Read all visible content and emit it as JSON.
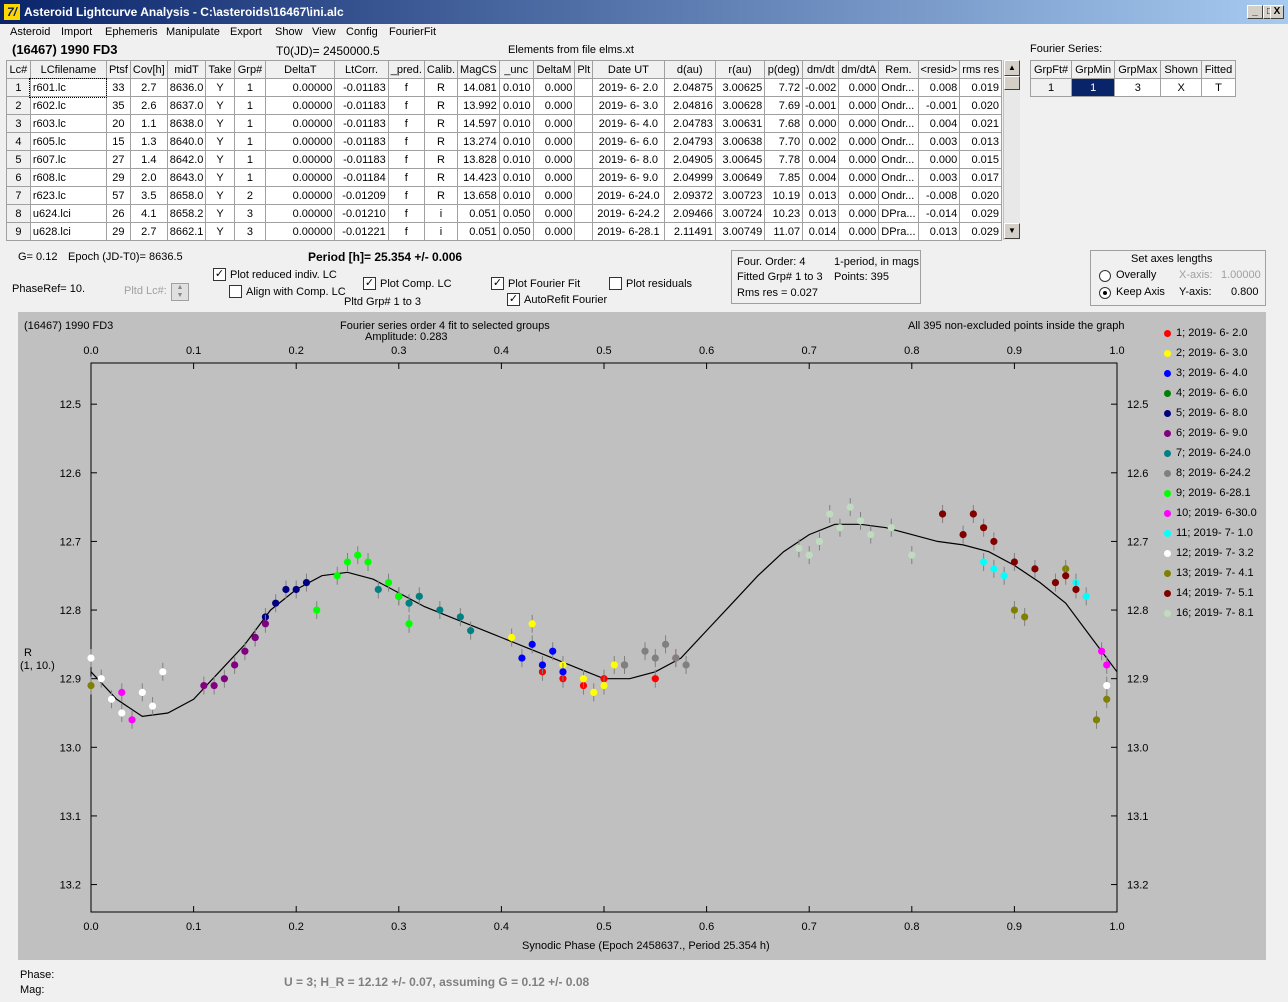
{
  "window": {
    "title": "Asteroid Lightcurve Analysis - C:\\asteroids\\16467\\ini.alc",
    "app_icon": "7/",
    "min": "_",
    "max": "□",
    "close": "X"
  },
  "menu": [
    "Asteroid",
    "Import",
    "Ephemeris",
    "Manipulate",
    "Export",
    "Show",
    "View",
    "Config",
    "FourierFit"
  ],
  "header": {
    "object": "(16467) 1990 FD3",
    "t0": "T0(JD)= 2450000.5",
    "elements": "Elements from file elms.xt",
    "fourier_series_label": "Fourier Series:"
  },
  "table": {
    "columns": [
      "Lc#",
      "LCfilename",
      "Ptsf",
      "Cov[h]",
      "midT",
      "Take",
      "Grp#",
      "DeltaT",
      "LtCorr.",
      "_pred.",
      "Calib.",
      "MagCS",
      "_unc",
      "DeltaM",
      "Plt",
      "Date UT",
      "d(au)",
      "r(au)",
      "p(deg)",
      "dm/dt",
      "dm/dtA",
      "Rem.",
      "<resid>",
      "rms res"
    ],
    "rows": [
      [
        "1",
        "r601.lc",
        "33",
        "2.7",
        "8636.0",
        "Y",
        "1",
        "0.00000",
        "-0.01183",
        "f",
        "R",
        "14.081",
        "0.010",
        "0.000",
        "",
        "2019- 6- 2.0",
        "2.04875",
        "3.00625",
        "7.72",
        "-0.002",
        "0.000",
        "Ondr...",
        "0.008",
        "0.019"
      ],
      [
        "2",
        "r602.lc",
        "35",
        "2.6",
        "8637.0",
        "Y",
        "1",
        "0.00000",
        "-0.01183",
        "f",
        "R",
        "13.992",
        "0.010",
        "0.000",
        "",
        "2019- 6- 3.0",
        "2.04816",
        "3.00628",
        "7.69",
        "-0.001",
        "0.000",
        "Ondr...",
        "-0.001",
        "0.020"
      ],
      [
        "3",
        "r603.lc",
        "20",
        "1.1",
        "8638.0",
        "Y",
        "1",
        "0.00000",
        "-0.01183",
        "f",
        "R",
        "14.597",
        "0.010",
        "0.000",
        "",
        "2019- 6- 4.0",
        "2.04783",
        "3.00631",
        "7.68",
        "0.000",
        "0.000",
        "Ondr...",
        "0.004",
        "0.021"
      ],
      [
        "4",
        "r605.lc",
        "15",
        "1.3",
        "8640.0",
        "Y",
        "1",
        "0.00000",
        "-0.01183",
        "f",
        "R",
        "13.274",
        "0.010",
        "0.000",
        "",
        "2019- 6- 6.0",
        "2.04793",
        "3.00638",
        "7.70",
        "0.002",
        "0.000",
        "Ondr...",
        "0.003",
        "0.013"
      ],
      [
        "5",
        "r607.lc",
        "27",
        "1.4",
        "8642.0",
        "Y",
        "1",
        "0.00000",
        "-0.01183",
        "f",
        "R",
        "13.828",
        "0.010",
        "0.000",
        "",
        "2019- 6- 8.0",
        "2.04905",
        "3.00645",
        "7.78",
        "0.004",
        "0.000",
        "Ondr...",
        "0.000",
        "0.015"
      ],
      [
        "6",
        "r608.lc",
        "29",
        "2.0",
        "8643.0",
        "Y",
        "1",
        "0.00000",
        "-0.01184",
        "f",
        "R",
        "14.423",
        "0.010",
        "0.000",
        "",
        "2019- 6- 9.0",
        "2.04999",
        "3.00649",
        "7.85",
        "0.004",
        "0.000",
        "Ondr...",
        "0.003",
        "0.017"
      ],
      [
        "7",
        "r623.lc",
        "57",
        "3.5",
        "8658.0",
        "Y",
        "2",
        "0.00000",
        "-0.01209",
        "f",
        "R",
        "13.658",
        "0.010",
        "0.000",
        "",
        "2019- 6-24.0",
        "2.09372",
        "3.00723",
        "10.19",
        "0.013",
        "0.000",
        "Ondr...",
        "-0.008",
        "0.020"
      ],
      [
        "8",
        "u624.lci",
        "26",
        "4.1",
        "8658.2",
        "Y",
        "3",
        "0.00000",
        "-0.01210",
        "f",
        "i",
        "0.051",
        "0.050",
        "0.000",
        "",
        "2019- 6-24.2",
        "2.09466",
        "3.00724",
        "10.23",
        "0.013",
        "0.000",
        "DPra...",
        "-0.014",
        "0.029"
      ],
      [
        "9",
        "u628.lci",
        "29",
        "2.7",
        "8662.1",
        "Y",
        "3",
        "0.00000",
        "-0.01221",
        "f",
        "i",
        "0.051",
        "0.050",
        "0.000",
        "",
        "2019- 6-28.1",
        "2.11491",
        "3.00749",
        "11.07",
        "0.014",
        "0.000",
        "DPra...",
        "0.013",
        "0.029"
      ]
    ]
  },
  "fourier_table": {
    "columns": [
      "GrpFt#",
      "GrpMin",
      "GrpMax",
      "Shown",
      "Fitted"
    ],
    "row": [
      "1",
      "1",
      "3",
      "X",
      "T"
    ]
  },
  "params": {
    "g": "G= 0.12",
    "epoch": "Epoch (JD-T0)= 8636.5",
    "period": "Period [h]= 25.354 +/- 0.006",
    "phaseref": "PhaseRef= 10.",
    "pltd_lc": "Pltd Lc#:",
    "pltd_grp": "Pltd Grp#  1   to   3"
  },
  "checks": {
    "plot_reduced": {
      "label": "Plot reduced indiv. LC",
      "checked": true
    },
    "align": {
      "label": "Align with Comp. LC",
      "checked": false
    },
    "plot_comp": {
      "label": "Plot Comp. LC",
      "checked": true
    },
    "plot_fourier": {
      "label": "Plot Fourier Fit",
      "checked": true
    },
    "autorefit": {
      "label": "AutoRefit Fourier",
      "checked": true
    },
    "plot_resid": {
      "label": "Plot residuals",
      "checked": false
    }
  },
  "info": {
    "order": "Four. Order:  4",
    "period_mode": "1-period, in mags",
    "fitted": "Fitted Grp# 1 to 3",
    "points": "Points: 395",
    "rms": "Rms res     = 0.027"
  },
  "axes_panel": {
    "title": "Set axes lengths",
    "overally": "Overally",
    "keep": "Keep Axis",
    "xlabel": "X-axis:",
    "xval": "1.00000",
    "ylabel": "Y-axis:",
    "yval": "0.800"
  },
  "plot": {
    "object": "(16467) 1990 FD3",
    "fit_title": "Fourier series order 4 fit to selected groups",
    "amplitude": "Amplitude: 0.283",
    "points_note": "All 395 non-excluded points inside the graph",
    "xlabel": "Synodic Phase (Epoch 2458637., Period 25.354 h)",
    "ylabel1": "R",
    "ylabel2": "(1, 10.)",
    "xticks": [
      "0.0",
      "0.1",
      "0.2",
      "0.3",
      "0.4",
      "0.5",
      "0.6",
      "0.7",
      "0.8",
      "0.9",
      "1.0"
    ],
    "yticks": [
      "12.5",
      "12.6",
      "12.7",
      "12.8",
      "12.9",
      "13.0",
      "13.1",
      "13.2"
    ]
  },
  "legend": [
    {
      "label": "1; 2019- 6- 2.0",
      "color": "#ff0000"
    },
    {
      "label": "2; 2019- 6- 3.0",
      "color": "#ffff00"
    },
    {
      "label": "3; 2019- 6- 4.0",
      "color": "#0000ff"
    },
    {
      "label": "4; 2019- 6- 6.0",
      "color": "#008000"
    },
    {
      "label": "5; 2019- 6- 8.0",
      "color": "#000080"
    },
    {
      "label": "6; 2019- 6- 9.0",
      "color": "#800080"
    },
    {
      "label": "7; 2019- 6-24.0",
      "color": "#008080"
    },
    {
      "label": "8; 2019- 6-24.2",
      "color": "#808080"
    },
    {
      "label": "9; 2019- 6-28.1",
      "color": "#00ff00"
    },
    {
      "label": "10; 2019- 6-30.0",
      "color": "#ff00ff"
    },
    {
      "label": "11; 2019- 7- 1.0",
      "color": "#00ffff"
    },
    {
      "label": "12; 2019- 7- 3.2",
      "color": "#ffffff"
    },
    {
      "label": "13; 2019- 7- 4.1",
      "color": "#808000"
    },
    {
      "label": "14; 2019- 7- 5.1",
      "color": "#800000"
    },
    {
      "label": "16; 2019- 7- 8.1",
      "color": "#c0dcc0"
    }
  ],
  "chart_data": {
    "type": "scatter",
    "xlim": [
      0,
      1
    ],
    "ylim": [
      13.2,
      12.4
    ],
    "inverted_y": true,
    "fourier_curve": [
      [
        0,
        12.89
      ],
      [
        0.025,
        12.93
      ],
      [
        0.05,
        12.955
      ],
      [
        0.075,
        12.95
      ],
      [
        0.1,
        12.93
      ],
      [
        0.125,
        12.89
      ],
      [
        0.15,
        12.85
      ],
      [
        0.175,
        12.8
      ],
      [
        0.2,
        12.77
      ],
      [
        0.225,
        12.75
      ],
      [
        0.25,
        12.745
      ],
      [
        0.275,
        12.755
      ],
      [
        0.3,
        12.775
      ],
      [
        0.325,
        12.795
      ],
      [
        0.35,
        12.81
      ],
      [
        0.375,
        12.825
      ],
      [
        0.4,
        12.84
      ],
      [
        0.425,
        12.855
      ],
      [
        0.45,
        12.87
      ],
      [
        0.475,
        12.885
      ],
      [
        0.5,
        12.9
      ],
      [
        0.525,
        12.9
      ],
      [
        0.55,
        12.89
      ],
      [
        0.575,
        12.87
      ],
      [
        0.6,
        12.83
      ],
      [
        0.625,
        12.79
      ],
      [
        0.65,
        12.75
      ],
      [
        0.675,
        12.715
      ],
      [
        0.7,
        12.69
      ],
      [
        0.725,
        12.675
      ],
      [
        0.75,
        12.675
      ],
      [
        0.775,
        12.68
      ],
      [
        0.8,
        12.69
      ],
      [
        0.825,
        12.7
      ],
      [
        0.85,
        12.705
      ],
      [
        0.875,
        12.715
      ],
      [
        0.9,
        12.735
      ],
      [
        0.925,
        12.76
      ],
      [
        0.95,
        12.79
      ],
      [
        0.975,
        12.84
      ],
      [
        1.0,
        12.89
      ]
    ],
    "groups": [
      {
        "legend": 0,
        "x": [
          0.44,
          0.46,
          0.48,
          0.5,
          0.52,
          0.55,
          0.57
        ],
        "y": [
          12.89,
          12.9,
          12.91,
          12.9,
          12.88,
          12.9,
          12.87
        ]
      },
      {
        "legend": 1,
        "x": [
          0.41,
          0.43,
          0.46,
          0.48,
          0.49,
          0.5,
          0.51
        ],
        "y": [
          12.84,
          12.82,
          12.88,
          12.9,
          12.92,
          12.91,
          12.88
        ]
      },
      {
        "legend": 2,
        "x": [
          0.42,
          0.43,
          0.44,
          0.45,
          0.46
        ],
        "y": [
          12.87,
          12.85,
          12.88,
          12.86,
          12.89
        ]
      },
      {
        "legend": 4,
        "x": [
          0.16,
          0.17,
          0.18,
          0.19,
          0.2,
          0.21
        ],
        "y": [
          12.84,
          12.81,
          12.79,
          12.77,
          12.77,
          12.76
        ]
      },
      {
        "legend": 5,
        "x": [
          0.11,
          0.12,
          0.13,
          0.14,
          0.15,
          0.16,
          0.17
        ],
        "y": [
          12.91,
          12.91,
          12.9,
          12.88,
          12.86,
          12.84,
          12.82
        ]
      },
      {
        "legend": 6,
        "x": [
          0.28,
          0.3,
          0.31,
          0.32,
          0.34,
          0.36,
          0.37
        ],
        "y": [
          12.77,
          12.78,
          12.79,
          12.78,
          12.8,
          12.81,
          12.83
        ]
      },
      {
        "legend": 7,
        "x": [
          0.52,
          0.54,
          0.55,
          0.56,
          0.57,
          0.58
        ],
        "y": [
          12.88,
          12.86,
          12.87,
          12.85,
          12.87,
          12.88
        ]
      },
      {
        "legend": 8,
        "x": [
          0.22,
          0.24,
          0.25,
          0.26,
          0.27,
          0.29,
          0.3,
          0.31
        ],
        "y": [
          12.8,
          12.75,
          12.73,
          12.72,
          12.73,
          12.76,
          12.78,
          12.82
        ]
      },
      {
        "legend": 9,
        "x": [
          0.03,
          0.04,
          0.985,
          0.99
        ],
        "y": [
          12.92,
          12.96,
          12.86,
          12.88
        ]
      },
      {
        "legend": 10,
        "x": [
          0.87,
          0.88,
          0.89,
          0.96,
          0.97
        ],
        "y": [
          12.73,
          12.74,
          12.75,
          12.76,
          12.78
        ]
      },
      {
        "legend": 11,
        "x": [
          0.0,
          0.01,
          0.02,
          0.03,
          0.05,
          0.06,
          0.07,
          0.99
        ],
        "y": [
          12.87,
          12.9,
          12.93,
          12.95,
          12.92,
          12.94,
          12.89,
          12.91
        ]
      },
      {
        "legend": 12,
        "x": [
          0.0,
          0.9,
          0.91,
          0.95,
          0.98,
          0.99
        ],
        "y": [
          12.91,
          12.8,
          12.81,
          12.74,
          12.96,
          12.93
        ]
      },
      {
        "legend": 13,
        "x": [
          0.83,
          0.85,
          0.86,
          0.87,
          0.88,
          0.9,
          0.92,
          0.94,
          0.95,
          0.96
        ],
        "y": [
          12.66,
          12.69,
          12.66,
          12.68,
          12.7,
          12.73,
          12.74,
          12.76,
          12.75,
          12.77
        ]
      },
      {
        "legend": 14,
        "x": [
          0.69,
          0.7,
          0.71,
          0.72,
          0.73,
          0.74,
          0.75,
          0.76,
          0.78,
          0.8
        ],
        "y": [
          12.71,
          12.72,
          12.7,
          12.66,
          12.68,
          12.65,
          12.67,
          12.69,
          12.68,
          12.72
        ]
      }
    ]
  },
  "status": {
    "phase": "Phase:",
    "mag": "Mag:",
    "result": "U = 3; H_R = 12.12 +/- 0.07, assuming G = 0.12 +/- 0.08"
  }
}
